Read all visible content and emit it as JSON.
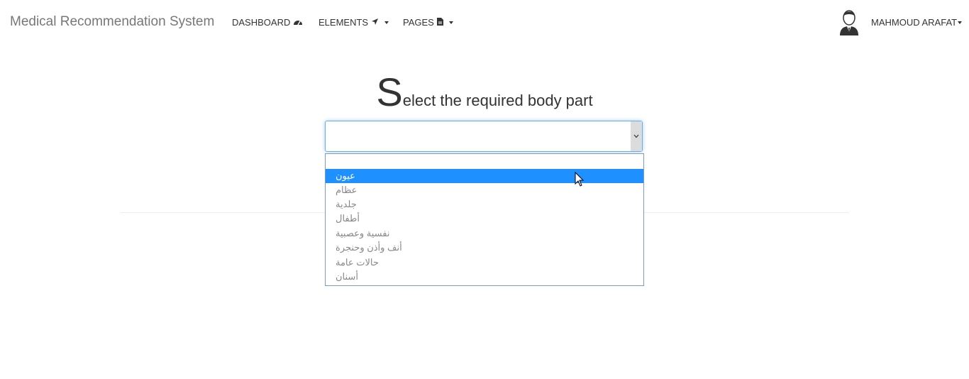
{
  "navbar": {
    "brand": "Medical Recommendation System",
    "items": [
      {
        "label": "DASHBOARD",
        "icon": "dashboard-icon"
      },
      {
        "label": "ELEMENTS",
        "icon": "send-icon"
      },
      {
        "label": "PAGES",
        "icon": "file-icon"
      }
    ],
    "user": {
      "name": "MAHMOUD ARAFAT",
      "avatar": "user-avatar-icon"
    }
  },
  "main": {
    "heading_first_letter": "S",
    "heading_rest": "elect the required body part",
    "select": {
      "value": "",
      "options": [
        "",
        "عيون",
        "عظام",
        "جلدية",
        "أطفال",
        "نفسية وعصبية",
        "أنف وأذن وحنجرة",
        "حالات عامة",
        "أسنان"
      ],
      "highlighted_index": 1
    }
  },
  "colors": {
    "highlight": "#1e90ff",
    "focus_border": "#66afe9"
  }
}
